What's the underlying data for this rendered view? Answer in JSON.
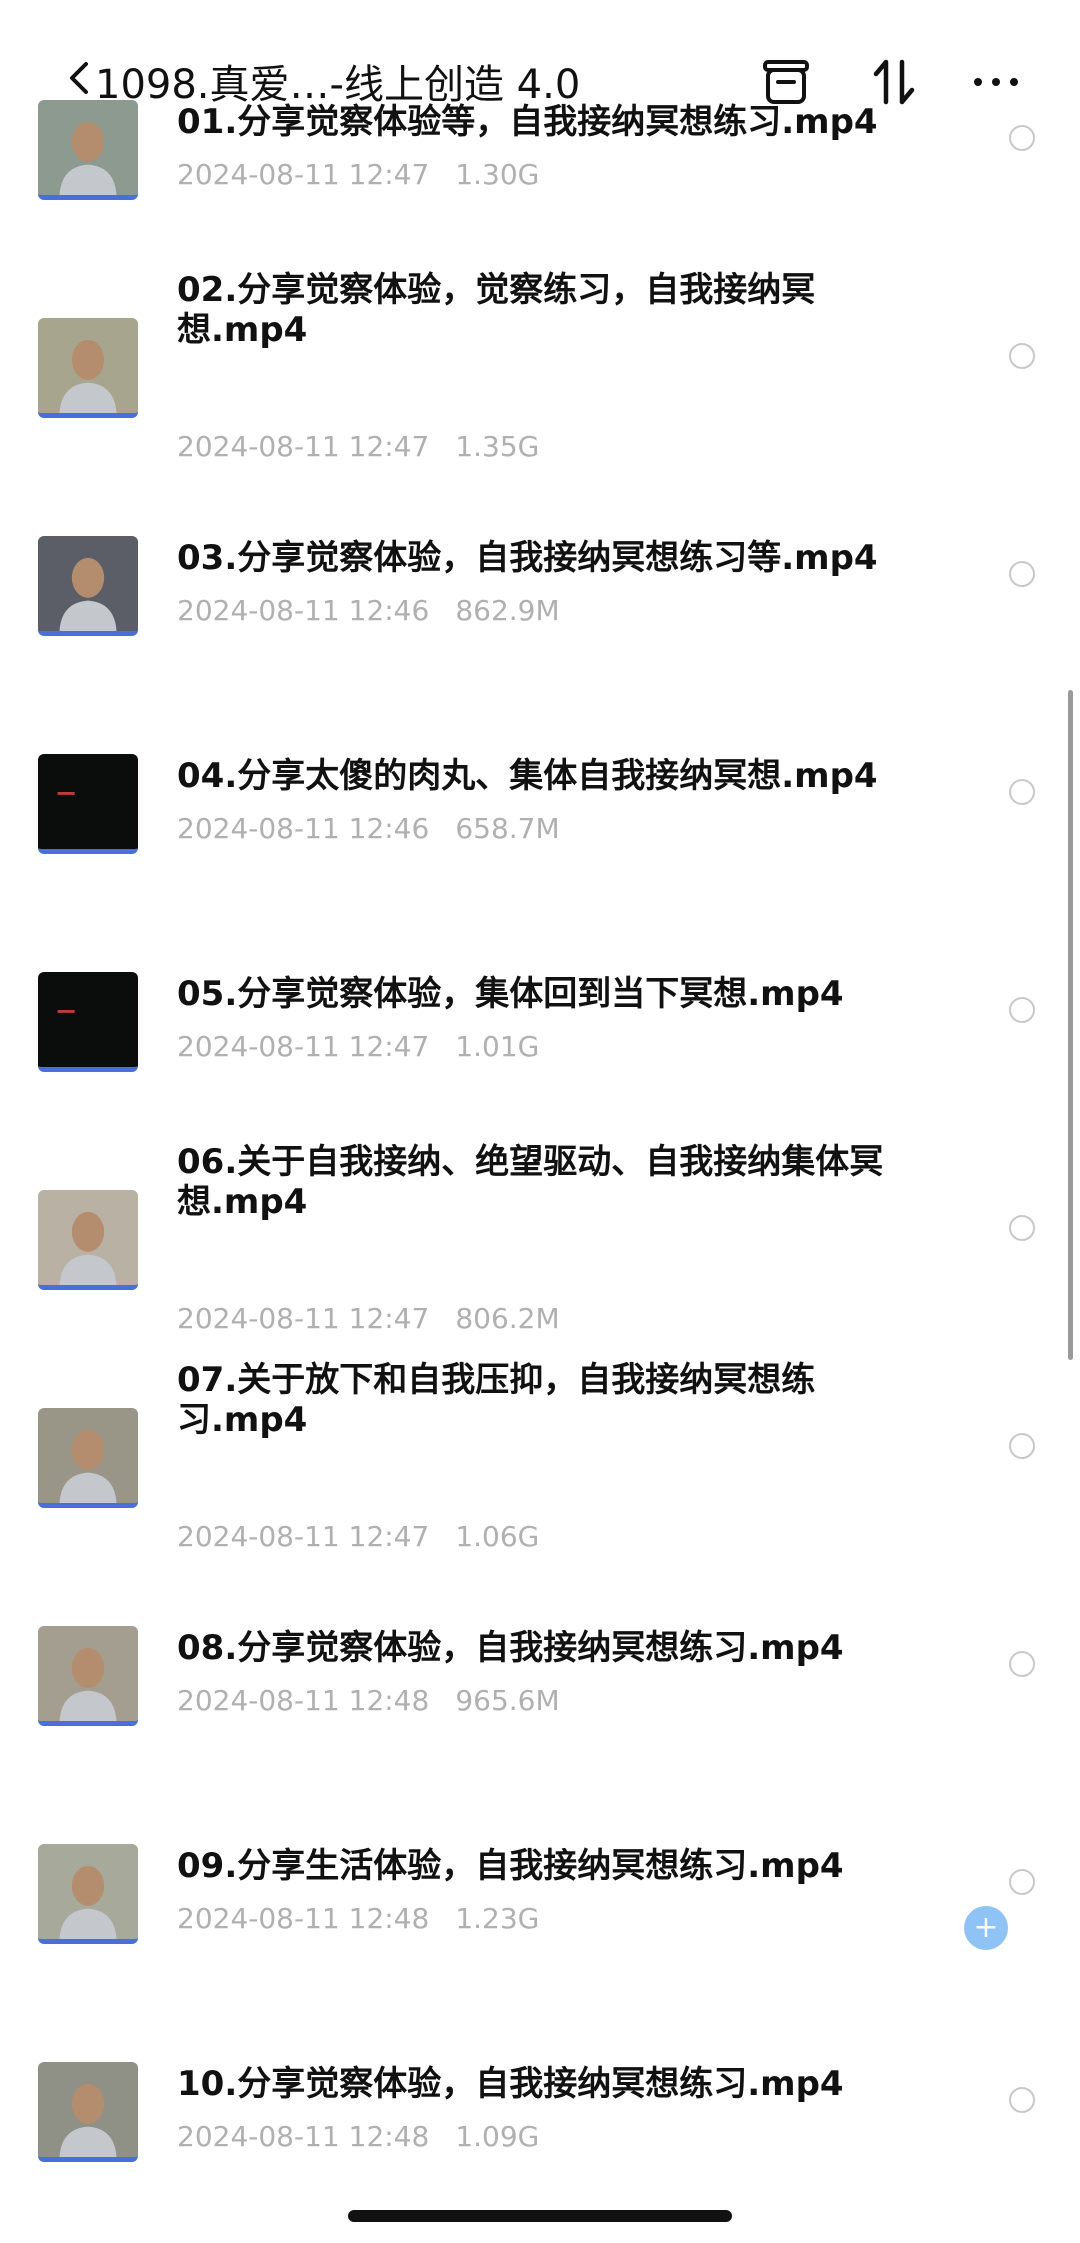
{
  "header": {
    "back_icon": "chevron-left-icon",
    "title": "1098.真爱…-线上创造 4.0",
    "actions": [
      {
        "name": "archive",
        "icon": "archive-icon"
      },
      {
        "name": "sort",
        "icon": "sort-icon"
      },
      {
        "name": "more",
        "icon": "more-icon"
      }
    ]
  },
  "files": [
    {
      "name": "01.分享觉察体验等，自我接纳冥想练习.mp4",
      "date": "2024-08-11 12:47",
      "size": "1.30G",
      "thumb_color": "#8d9a8f"
    },
    {
      "name": "02.分享觉察体验，觉察练习，自我接纳冥想.mp4",
      "date": "2024-08-11 12:47",
      "size": "1.35G",
      "thumb_color": "#a7a58d"
    },
    {
      "name": "03.分享觉察体验，自我接纳冥想练习等.mp4",
      "date": "2024-08-11 12:46",
      "size": "862.9M",
      "thumb_color": "#5b5e66"
    },
    {
      "name": "04.分享太傻的肉丸、集体自我接纳冥想.mp4",
      "date": "2024-08-11 12:46",
      "size": "658.7M",
      "thumb_color": "#0b0d0c"
    },
    {
      "name": "05.分享觉察体验，集体回到当下冥想.mp4",
      "date": "2024-08-11 12:47",
      "size": "1.01G",
      "thumb_color": "#0b0d0c"
    },
    {
      "name": "06.关于自我接纳、绝望驱动、自我接纳集体冥想.mp4",
      "date": "2024-08-11 12:47",
      "size": "806.2M",
      "thumb_color": "#b9b2a4"
    },
    {
      "name": "07.关于放下和自我压抑，自我接纳冥想练习.mp4",
      "date": "2024-08-11 12:47",
      "size": "1.06G",
      "thumb_color": "#9a9687"
    },
    {
      "name": "08.分享觉察体验，自我接纳冥想练习.mp4",
      "date": "2024-08-11 12:48",
      "size": "965.6M",
      "thumb_color": "#a49e90"
    },
    {
      "name": "09.分享生活体验，自我接纳冥想练习.mp4",
      "date": "2024-08-11 12:48",
      "size": "1.23G",
      "thumb_color": "#a7a99b"
    },
    {
      "name": "10.分享觉察体验，自我接纳冥想练习.mp4",
      "date": "2024-08-11 12:48",
      "size": "1.09G",
      "thumb_color": "#8f9187"
    }
  ],
  "float_button": {
    "label": "+",
    "icon": "add-icon"
  }
}
